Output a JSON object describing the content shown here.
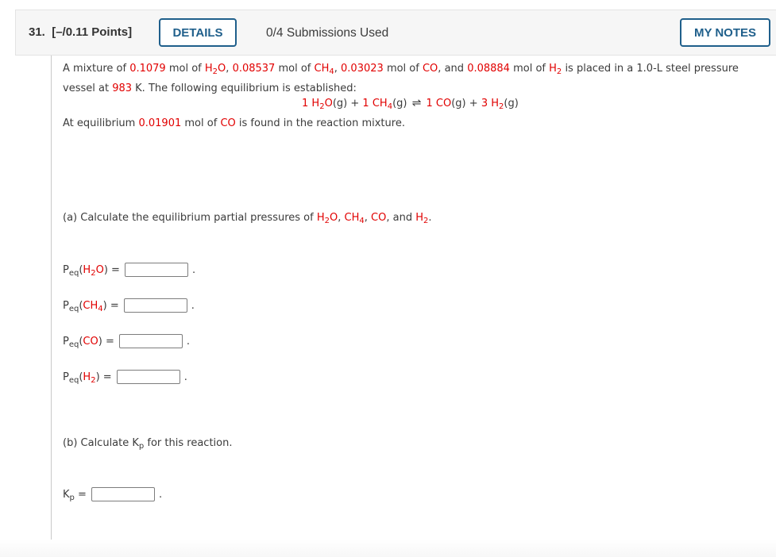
{
  "header": {
    "question_number": "31.",
    "points": "[–/0.11 Points]",
    "details_label": "DETAILS",
    "submissions": "0/4 Submissions Used",
    "my_notes_label": "MY NOTES"
  },
  "problem": {
    "intro": "A mixture of",
    "h2o_mol": "0.1079",
    "ch4_mol": "0.08537",
    "co_mol": "0.03023",
    "h2_mol": "0.08884",
    "mol_of": "mol of",
    "and": "and",
    "vessel_text": "is placed in a 1.0-L steel pressure",
    "vessel_text2": "vessel at",
    "temperature": "983",
    "temp_unit_text": "K. The following equilibrium is established:",
    "equilibrium_intro": "At equilibrium",
    "co_eq_mol": "0.01901",
    "equilibrium_rest": "is found in the reaction mixture."
  },
  "reaction": {
    "coef_h2o": "1",
    "coef_ch4": "1",
    "coef_co": "1",
    "coef_h2": "3",
    "phase": "(g)",
    "plus": "+",
    "arrow": "⇌"
  },
  "species": {
    "h2o": {
      "base": "H",
      "sub": "2",
      "tail": "O"
    },
    "ch4": {
      "base": "CH",
      "sub": "4"
    },
    "co": {
      "base": "CO"
    },
    "h2": {
      "base": "H",
      "sub": "2"
    }
  },
  "part_a": {
    "prompt": "(a) Calculate the equilibrium partial pressures of",
    "answers": [
      {
        "label_p": "P",
        "label_sub": "eq",
        "value": ""
      },
      {
        "label_p": "P",
        "label_sub": "eq",
        "value": ""
      },
      {
        "label_p": "P",
        "label_sub": "eq",
        "value": ""
      },
      {
        "label_p": "P",
        "label_sub": "eq",
        "value": ""
      }
    ]
  },
  "part_b": {
    "prompt_pre": "(b) Calculate K",
    "prompt_sub": "p",
    "prompt_post": "for this reaction.",
    "kp_label": "K",
    "kp_sub": "p",
    "value": ""
  },
  "symbols": {
    "equals": "=",
    "period": ".",
    "comma": ",",
    "open": "(",
    "close": ")"
  }
}
